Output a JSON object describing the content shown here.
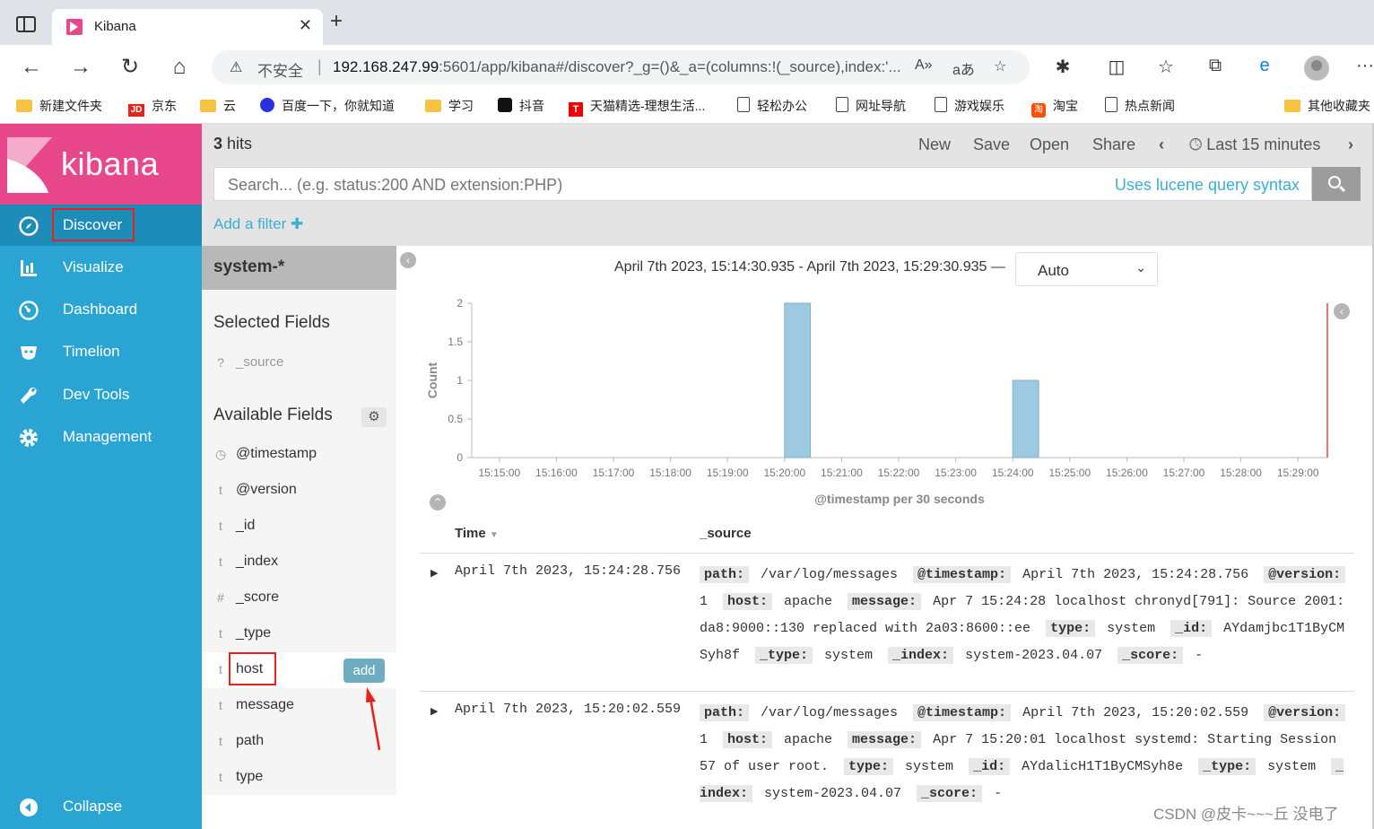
{
  "browser": {
    "tab_title": "Kibana",
    "url_insecure": "不安全",
    "url_host": "192.168.247.99",
    "url_rest": ":5601/app/kibana#/discover?_g=()&_a=(columns:!(_source),index:'...",
    "bookmarks": [
      {
        "label": "新建文件夹",
        "icon": "folder-icon"
      },
      {
        "label": "京东",
        "icon": "jd-icon"
      },
      {
        "label": "云",
        "icon": "folder-icon"
      },
      {
        "label": "百度一下，你就知道",
        "icon": "baidu-icon"
      },
      {
        "label": "学习",
        "icon": "folder-icon"
      },
      {
        "label": "抖音",
        "icon": "tiktok-icon"
      },
      {
        "label": "天猫精选-理想生活...",
        "icon": "tmall-icon"
      },
      {
        "label": "轻松办公",
        "icon": "page-icon"
      },
      {
        "label": "网址导航",
        "icon": "page-icon"
      },
      {
        "label": "游戏娱乐",
        "icon": "page-icon"
      },
      {
        "label": "淘宝",
        "icon": "taobao-icon"
      },
      {
        "label": "热点新闻",
        "icon": "page-icon"
      },
      {
        "label": "其他收藏夹",
        "icon": "folder-icon"
      }
    ]
  },
  "kibana": {
    "brand": "kibana",
    "nav": [
      {
        "label": "Discover",
        "icon": "compass-icon",
        "active": true
      },
      {
        "label": "Visualize",
        "icon": "bar-chart-icon"
      },
      {
        "label": "Dashboard",
        "icon": "dashboard-icon"
      },
      {
        "label": "Timelion",
        "icon": "timelion-icon"
      },
      {
        "label": "Dev Tools",
        "icon": "wrench-icon"
      },
      {
        "label": "Management",
        "icon": "gear-icon"
      }
    ],
    "collapse_label": "Collapse"
  },
  "top": {
    "hits_count": "3",
    "hits_label": " hits",
    "links": [
      "New",
      "Save",
      "Open",
      "Share"
    ],
    "time_range": "Last 15 minutes"
  },
  "search": {
    "placeholder": "Search... (e.g. status:200 AND extension:PHP)",
    "syntax_link": "Uses lucene query syntax"
  },
  "filter": {
    "add_label": "Add a filter"
  },
  "fields": {
    "index_pattern": "system-*",
    "selected_title": "Selected Fields",
    "selected": [
      {
        "type": "?",
        "name": "_source"
      }
    ],
    "available_title": "Available Fields",
    "available": [
      {
        "type": "clock",
        "name": "@timestamp"
      },
      {
        "type": "t",
        "name": "@version"
      },
      {
        "type": "t",
        "name": "_id"
      },
      {
        "type": "t",
        "name": "_index"
      },
      {
        "type": "#",
        "name": "_score"
      },
      {
        "type": "t",
        "name": "_type"
      },
      {
        "type": "t",
        "name": "host"
      },
      {
        "type": "t",
        "name": "message"
      },
      {
        "type": "t",
        "name": "path"
      },
      {
        "type": "t",
        "name": "type"
      }
    ],
    "add_button": "add"
  },
  "histogram": {
    "range_text": "April 7th 2023, 15:14:30.935 - April 7th 2023, 15:29:30.935 —",
    "interval": "Auto"
  },
  "chart_data": {
    "type": "bar",
    "x": [
      "15:15:00",
      "15:16:00",
      "15:17:00",
      "15:18:00",
      "15:19:00",
      "15:20:00",
      "15:21:00",
      "15:22:00",
      "15:23:00",
      "15:24:00",
      "15:25:00",
      "15:26:00",
      "15:27:00",
      "15:28:00",
      "15:29:00"
    ],
    "bars": [
      {
        "start": "15:20:00",
        "value": 2
      },
      {
        "start": "15:24:00",
        "value": 1
      }
    ],
    "ylabel": "Count",
    "xlabel": "@timestamp per 30 seconds",
    "yticks": [
      "0",
      "0.5",
      "1",
      "1.5",
      "2"
    ],
    "ylim": [
      0,
      2
    ],
    "xlim": [
      "15:14:30.935",
      "15:29:30.935"
    ],
    "colors": {
      "bar": "#9ecae1",
      "bar_stroke": "#7bb0c7",
      "now_line": "#e57373"
    }
  },
  "table": {
    "col_time": "Time",
    "col_source": "_source",
    "rows": [
      {
        "time": "April 7th 2023, 15:24:28.756",
        "fields": [
          {
            "k": "path:",
            "v": "/var/log/messages"
          },
          {
            "k": "@timestamp:",
            "v": "April 7th 2023, 15:24:28.756"
          },
          {
            "k": "@version:",
            "v": "1"
          },
          {
            "k": "host:",
            "v": "apache"
          },
          {
            "k": "message:",
            "v": "Apr 7 15:24:28 localhost chronyd[791]: Source 2001:da8:9000::130 replaced with 2a03:8600::ee"
          },
          {
            "k": "type:",
            "v": "system"
          },
          {
            "k": "_id:",
            "v": "AYdamjbc1T1ByCMSyh8f"
          },
          {
            "k": "_type:",
            "v": "system"
          },
          {
            "k": "_index:",
            "v": "system-2023.04.07"
          },
          {
            "k": "_score:",
            "v": " -"
          }
        ]
      },
      {
        "time": "April 7th 2023, 15:20:02.559",
        "fields": [
          {
            "k": "path:",
            "v": "/var/log/messages"
          },
          {
            "k": "@timestamp:",
            "v": "April 7th 2023, 15:20:02.559"
          },
          {
            "k": "@version:",
            "v": "1"
          },
          {
            "k": "host:",
            "v": "apache"
          },
          {
            "k": "message:",
            "v": "Apr 7 15:20:01 localhost systemd: Starting Session 57 of user root."
          },
          {
            "k": "type:",
            "v": "system"
          },
          {
            "k": "_id:",
            "v": "AYdalicH1T1ByCMSyh8e"
          },
          {
            "k": "_type:",
            "v": "system"
          },
          {
            "k": "_index:",
            "v": "system-2023.04.07"
          },
          {
            "k": "_score:",
            "v": " -"
          }
        ]
      }
    ]
  },
  "watermark": "CSDN @皮卡~~~丘 没电了"
}
